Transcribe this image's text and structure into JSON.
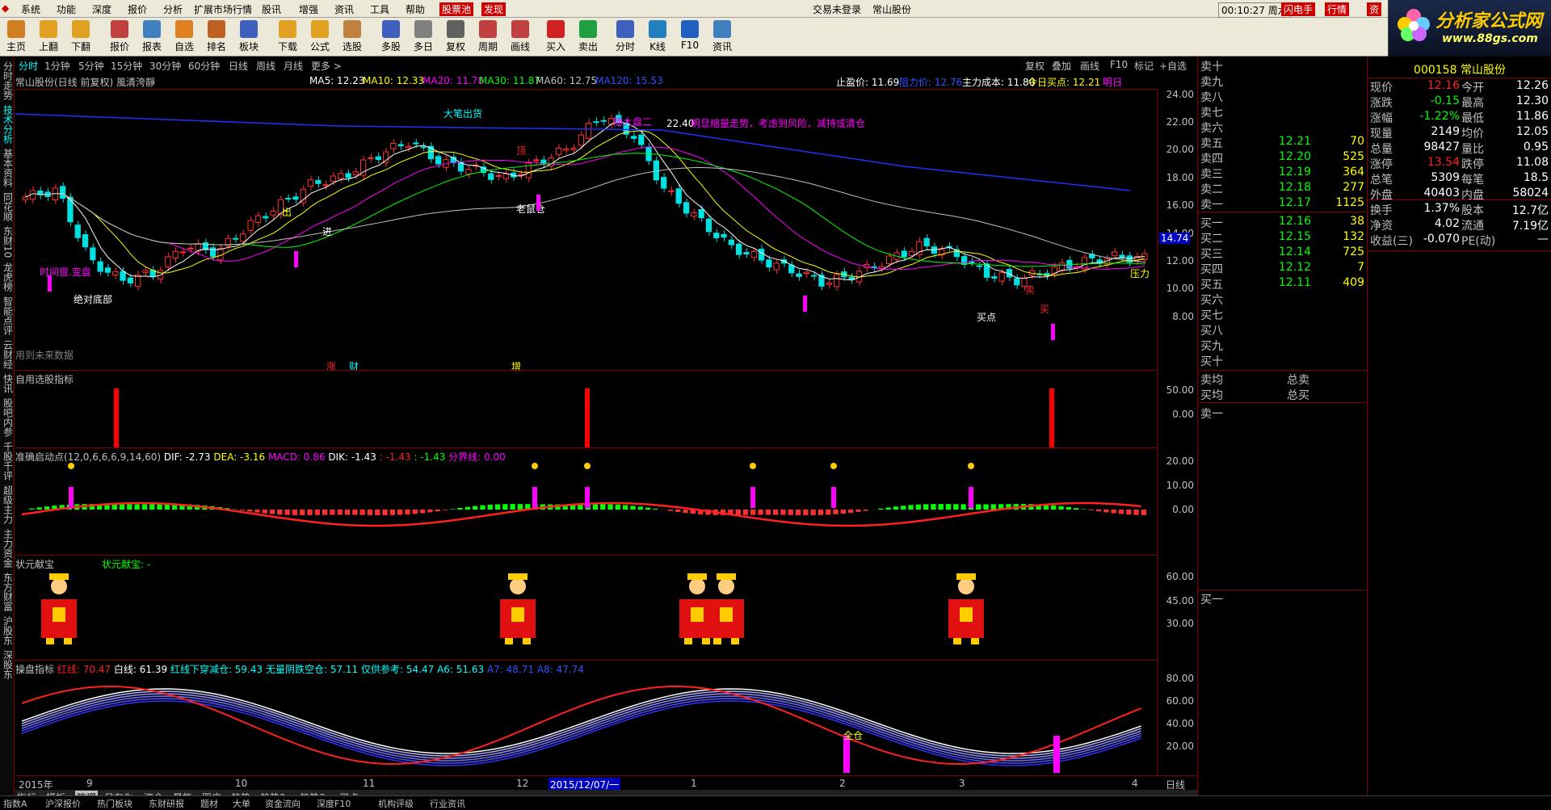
{
  "menu": {
    "items": [
      "系统",
      "功能",
      "深度",
      "报价",
      "分析",
      "扩展市场行情",
      "股讯",
      "增强",
      "资讯",
      "工具",
      "帮助",
      "股票池",
      "发现"
    ],
    "title": "交易未登录",
    "stock": "常山股份",
    "clock": "00:10:27 周六",
    "flash": "闪电手",
    "quote": "行情",
    "zi": "资"
  },
  "toolbar": [
    "主页",
    "上翻",
    "下翻",
    "报价",
    "报表",
    "自选",
    "排名",
    "板块",
    "下载",
    "公式",
    "选股",
    "多股",
    "多日",
    "复权",
    "周期",
    "画线",
    "买入",
    "卖出",
    "分时",
    "K线",
    "F10",
    "资讯"
  ],
  "logo": {
    "line1": "分析家公式网",
    "line2": "www.88gs.com"
  },
  "leftnav": [
    "分时走势",
    "技术分析",
    "基本资料",
    "同花顺",
    "东财10",
    "龙虎榜",
    "智能点评",
    "云财经",
    "快讯",
    "股吧内参",
    "千股千评",
    "超级主力",
    "主力资金",
    "东方财富",
    "沪股东",
    "深股东"
  ],
  "periods": {
    "items": [
      "分时",
      "1分钟",
      "5分钟",
      "15分钟",
      "30分钟",
      "60分钟",
      "日线",
      "周线",
      "月线",
      "更多 >"
    ],
    "active": "分时",
    "right": [
      "复权",
      "叠加",
      "画线",
      "F10",
      "标记",
      "+自选"
    ]
  },
  "main": {
    "name": "常山股份(日线 前复权) 風清洿靜",
    "ma5": "MA5: 12.23",
    "ma10": "MA10: 12.33",
    "ma20": "MA20: 11.78",
    "ma30": "MA30: 11.87",
    "ma60": "MA60: 12.75",
    "ma120": "MA120: 15.53",
    "stop": "止盈价: 11.69",
    "resist": "阻力价: 12.76",
    "cost": "主力成本: 11.80",
    "buy": "今日买点: 12.21",
    "tomorrow": "明日",
    "no_future": "用到未来数据",
    "price_ticks": [
      "24.00",
      "22.00",
      "20.00",
      "18.00",
      "16.00",
      "14.00",
      "12.00",
      "10.00",
      "8.00"
    ],
    "current_tag": "14.74",
    "annotations": [
      "大笔出货",
      "随大盘二",
      "22.40",
      "明显缩量走势，考虑到风险，减持或清仓",
      "进",
      "出",
      "顶",
      "老鼠仓",
      "时间窗.变盘",
      "绝对底部",
      "买点",
      "压力",
      "卖",
      "买"
    ],
    "bottom_labels": [
      "涨",
      "财",
      "增"
    ]
  },
  "panel2": {
    "title": "自用选股指标",
    "ticks": [
      "50.00",
      "0.00"
    ]
  },
  "panel3": {
    "title": "准确启动点(12,0,6,6,6,9,14,60)",
    "dif": "DIF: -2.73",
    "dea": "DEA: -3.16",
    "macd": "MACD: 0.86",
    "dik": "DIK: -1.43",
    "v1": ": -1.43",
    "v2": ": -1.43",
    "fen": "分界线: 0.00",
    "ticks": [
      "20.00",
      "10.00",
      "0.00"
    ]
  },
  "panel4": {
    "title": "状元献宝",
    "sub": "状元献宝: -",
    "ticks": [
      "60.00",
      "45.00",
      "30.00"
    ]
  },
  "panel5": {
    "title": "操盘指标",
    "red": "红线: 70.47",
    "white": "白线: 61.39",
    "cross": "红线下穿减仓: 59.43",
    "noup": "无量阴跌空仓: 57.11",
    "ref": "仅供参考: 54.47",
    "a6": "A6: 51.63",
    "a7": "A7: 48.71",
    "a8": "A8: 47.74",
    "full": "全仓",
    "ticks": [
      "80.00",
      "60.00",
      "40.00",
      "20.00"
    ]
  },
  "datebar": {
    "labels": [
      "2015年",
      "9",
      "10",
      "11",
      "12",
      "2015/12/07/一",
      "1",
      "2",
      "3",
      "4"
    ],
    "period": "日线"
  },
  "tabs": [
    "指标",
    "模板",
    "管理",
    "另存为",
    "资金",
    "量能",
    "跟庄",
    "趋势",
    "趋势2",
    "趋势3",
    "买点"
  ],
  "tabs_active": "管理",
  "orderbook": {
    "asks": [
      {
        "label": "卖十",
        "price": "",
        "vol": ""
      },
      {
        "label": "卖九",
        "price": "",
        "vol": ""
      },
      {
        "label": "卖八",
        "price": "",
        "vol": ""
      },
      {
        "label": "卖七",
        "price": "",
        "vol": ""
      },
      {
        "label": "卖六",
        "price": "",
        "vol": ""
      },
      {
        "label": "卖五",
        "price": "12.21",
        "vol": "70"
      },
      {
        "label": "卖四",
        "price": "12.20",
        "vol": "525"
      },
      {
        "label": "卖三",
        "price": "12.19",
        "vol": "364"
      },
      {
        "label": "卖二",
        "price": "12.18",
        "vol": "277"
      },
      {
        "label": "卖一",
        "price": "12.17",
        "vol": "1125"
      }
    ],
    "bids": [
      {
        "label": "买一",
        "price": "12.16",
        "vol": "38"
      },
      {
        "label": "买二",
        "price": "12.15",
        "vol": "132"
      },
      {
        "label": "买三",
        "price": "12.14",
        "vol": "725"
      },
      {
        "label": "买四",
        "price": "12.12",
        "vol": "7"
      },
      {
        "label": "买五",
        "price": "12.11",
        "vol": "409"
      },
      {
        "label": "买六",
        "price": "",
        "vol": ""
      },
      {
        "label": "买七",
        "price": "",
        "vol": ""
      },
      {
        "label": "买八",
        "price": "",
        "vol": ""
      },
      {
        "label": "买九",
        "price": "",
        "vol": ""
      },
      {
        "label": "买十",
        "price": "",
        "vol": ""
      }
    ],
    "avg_sell": "卖均",
    "avg_buy": "买均",
    "total_sell": "总卖",
    "total_buy": "总买",
    "sell1": "卖一",
    "buy1": "买一"
  },
  "quote": {
    "title": "000158 常山股份",
    "rows": [
      [
        "现价",
        "12.16",
        "今开",
        "12.26"
      ],
      [
        "涨跌",
        "-0.15",
        "最高",
        "12.30"
      ],
      [
        "涨幅",
        "-1.22%",
        "最低",
        "11.86"
      ],
      [
        "现量",
        "2149",
        "均价",
        "12.05"
      ],
      [
        "总量",
        "98427",
        "量比",
        "0.95"
      ],
      [
        "涨停",
        "13.54",
        "跌停",
        "11.08"
      ],
      [
        "总笔",
        "5309",
        "每笔",
        "18.5"
      ],
      [
        "外盘",
        "40403",
        "内盘",
        "58024"
      ],
      [
        "换手",
        "1.37%",
        "股本",
        "12.7亿"
      ],
      [
        "净资",
        "4.02",
        "流通",
        "7.19亿"
      ],
      [
        "收益(三)",
        "-0.070",
        "PE(动)",
        "—"
      ]
    ]
  },
  "status": [
    "指数A",
    "沪深报价",
    "热门板块",
    "东财研报",
    "题材",
    "大单",
    "资金流向",
    "深度F10",
    "机构评级",
    "行业资讯"
  ],
  "colors": {
    "up": "#ff2020",
    "down": "#00ff00",
    "accent": "#ffff00",
    "frame": "#800000"
  }
}
